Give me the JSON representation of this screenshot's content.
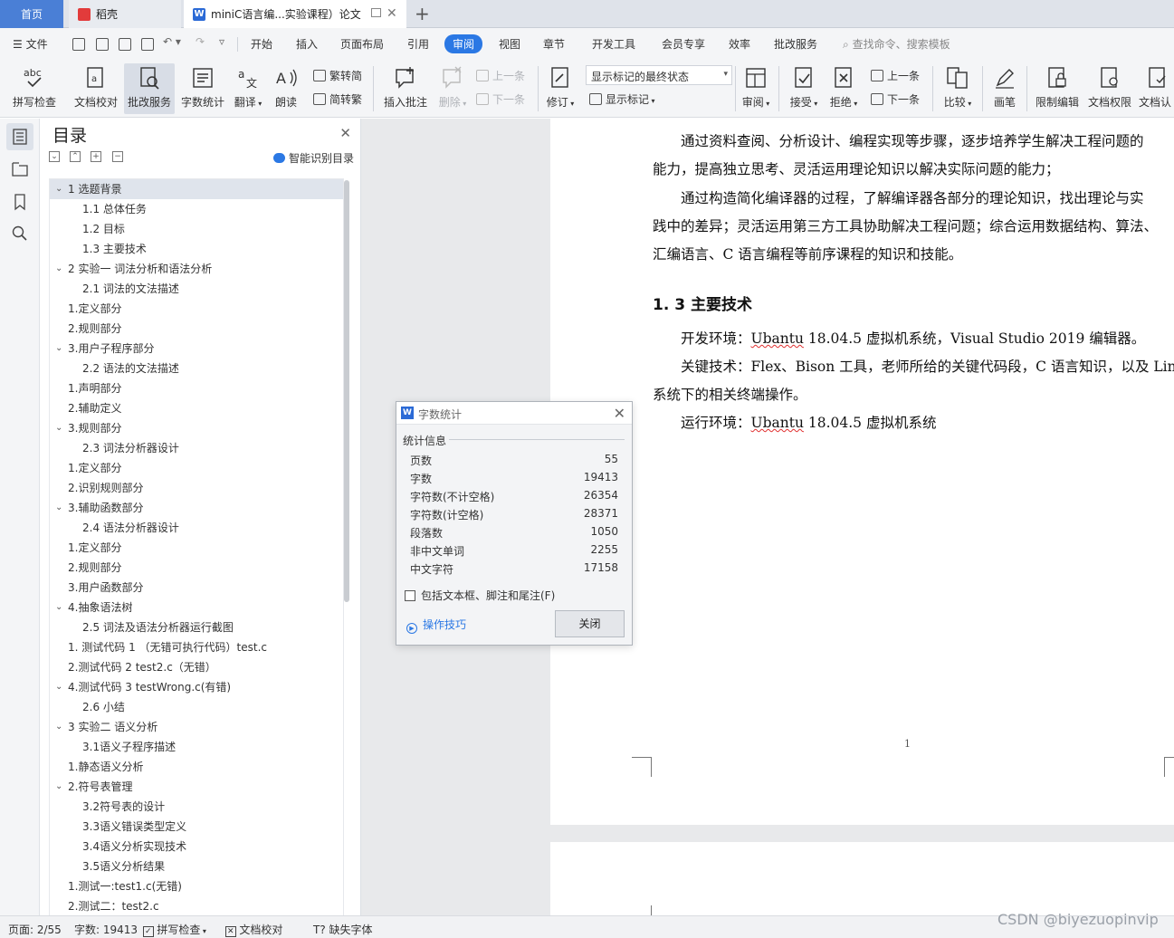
{
  "tabs": {
    "home": "首页",
    "docer": "稻壳",
    "doc": "miniC语言编...实验课程）论文"
  },
  "menu": {
    "file": "文件",
    "items": [
      "开始",
      "插入",
      "页面布局",
      "引用",
      "审阅",
      "视图",
      "章节",
      "开发工具",
      "会员专享",
      "效率",
      "批改服务"
    ],
    "active": "审阅",
    "search": "查找命令、搜索模板"
  },
  "ribbon": {
    "spell": "拼写检查",
    "proof": "文档校对",
    "grading": "批改服务",
    "wordcount": "字数统计",
    "translate": "翻译",
    "read": "朗读",
    "trad": "繁转简",
    "simp": "简转繁",
    "insert_comment": "插入批注",
    "delete": "删除",
    "prev": "上一条",
    "next": "下一条",
    "revise": "修订",
    "markup_state": "显示标记的最终状态",
    "show_markup": "显示标记",
    "review": "审阅",
    "accept": "接受",
    "reject": "拒绝",
    "prev2": "上一条",
    "next2": "下一条",
    "compare": "比较",
    "pen": "画笔",
    "restrict": "限制编辑",
    "permission": "文档权限",
    "certify": "文档认"
  },
  "toc": {
    "title": "目录",
    "smart": "智能识别目录",
    "items": [
      {
        "text": "1  选题背景",
        "level": 1,
        "expand": true,
        "selected": true
      },
      {
        "text": "1.1  总体任务",
        "level": 2
      },
      {
        "text": "1.2  目标",
        "level": 2
      },
      {
        "text": "1.3  主要技术",
        "level": 2
      },
      {
        "text": "2  实验一  词法分析和语法分析",
        "level": 1,
        "expand": true
      },
      {
        "text": "2.1  词法的文法描述",
        "level": 2
      },
      {
        "text": "1.定义部分",
        "level": 1
      },
      {
        "text": "2.规则部分",
        "level": 1
      },
      {
        "text": "3.用户子程序部分",
        "level": 1,
        "expand": true
      },
      {
        "text": "2.2  语法的文法描述",
        "level": 2
      },
      {
        "text": "1.声明部分",
        "level": 1
      },
      {
        "text": "2.辅助定义",
        "level": 1
      },
      {
        "text": "3.规则部分",
        "level": 1,
        "expand": true
      },
      {
        "text": "2.3  词法分析器设计",
        "level": 2
      },
      {
        "text": "1.定义部分",
        "level": 1
      },
      {
        "text": "2.识别规则部分",
        "level": 1
      },
      {
        "text": "3.辅助函数部分",
        "level": 1,
        "expand": true
      },
      {
        "text": "2.4  语法分析器设计",
        "level": 2
      },
      {
        "text": "1.定义部分",
        "level": 1
      },
      {
        "text": "2.规则部分",
        "level": 1
      },
      {
        "text": "3.用户函数部分",
        "level": 1
      },
      {
        "text": "4.抽象语法树",
        "level": 1,
        "expand": true
      },
      {
        "text": "2.5  词法及语法分析器运行截图",
        "level": 2
      },
      {
        "text": "1.  测试代码 1  （无错可执行代码）test.c",
        "level": 1
      },
      {
        "text": "2.测试代码 2    test2.c（无错）",
        "level": 1
      },
      {
        "text": "4.测试代码 3    testWrong.c(有错)",
        "level": 1,
        "expand": true
      },
      {
        "text": "2.6  小结",
        "level": 2
      },
      {
        "text": "3  实验二  语义分析",
        "level": 1,
        "expand": true
      },
      {
        "text": "3.1语义子程序描述",
        "level": 2
      },
      {
        "text": "1.静态语义分析",
        "level": 1
      },
      {
        "text": "2.符号表管理",
        "level": 1,
        "expand": true
      },
      {
        "text": "3.2符号表的设计",
        "level": 2
      },
      {
        "text": "3.3语义错误类型定义",
        "level": 2
      },
      {
        "text": "3.4语义分析实现技术",
        "level": 2
      },
      {
        "text": "3.5语义分析结果",
        "level": 2
      },
      {
        "text": "1.测试一:test1.c(无错)",
        "level": 1
      },
      {
        "text": "2.测试二：test2.c",
        "level": 1
      }
    ]
  },
  "document": {
    "p1_line1": "通过资料查阅、分析设计、编程实现等步骤，逐步培养学生解决工程问题的",
    "p1_line2": "能力，提高独立思考、灵活运用理论知识以解决实际问题的能力；",
    "p2_line1": "通过构造简化编译器的过程，了解编译器各部分的理论知识，找出理论与实",
    "p2_line2": "践中的差异；灵活运用第三方工具协助解决工程问题；综合运用数据结构、算法、",
    "p2_line3": "汇编语言、C 语言编程等前序课程的知识和技能。",
    "heading": "1. 3  主要技术",
    "env_prefix": "开发环境：",
    "env_ubuntu": "Ubantu",
    "env_rest": " 18.04.5 虚拟机系统，Visual Studio 2019 编辑器。",
    "key_line1": "关键技术：Flex、Bison 工具，老师所给的关键代码段，C 语言知识，以及 Linux",
    "key_line2": "系统下的相关终端操作。",
    "run_prefix": "运行环境：",
    "run_ubuntu": "Ubantu",
    "run_rest": " 18.04.5 虚拟机系统",
    "page_number": "1"
  },
  "wordcount": {
    "title": "字数统计",
    "section": "统计信息",
    "rows": [
      {
        "label": "页数",
        "value": "55"
      },
      {
        "label": "字数",
        "value": "19413"
      },
      {
        "label": "字符数(不计空格)",
        "value": "26354"
      },
      {
        "label": "字符数(计空格)",
        "value": "28371"
      },
      {
        "label": "段落数",
        "value": "1050"
      },
      {
        "label": "非中文单词",
        "value": "2255"
      },
      {
        "label": "中文字符",
        "value": "17158"
      }
    ],
    "include_label": "包括文本框、脚注和尾注(F)",
    "include_checked": false,
    "tips": "操作技巧",
    "close": "关闭"
  },
  "status": {
    "page": "页面: 2/55",
    "words": "字数: 19413",
    "spell": "拼写检查",
    "proof": "文档校对",
    "missing_font": "缺失字体"
  },
  "watermark": "CSDN @biyezuopinvip"
}
